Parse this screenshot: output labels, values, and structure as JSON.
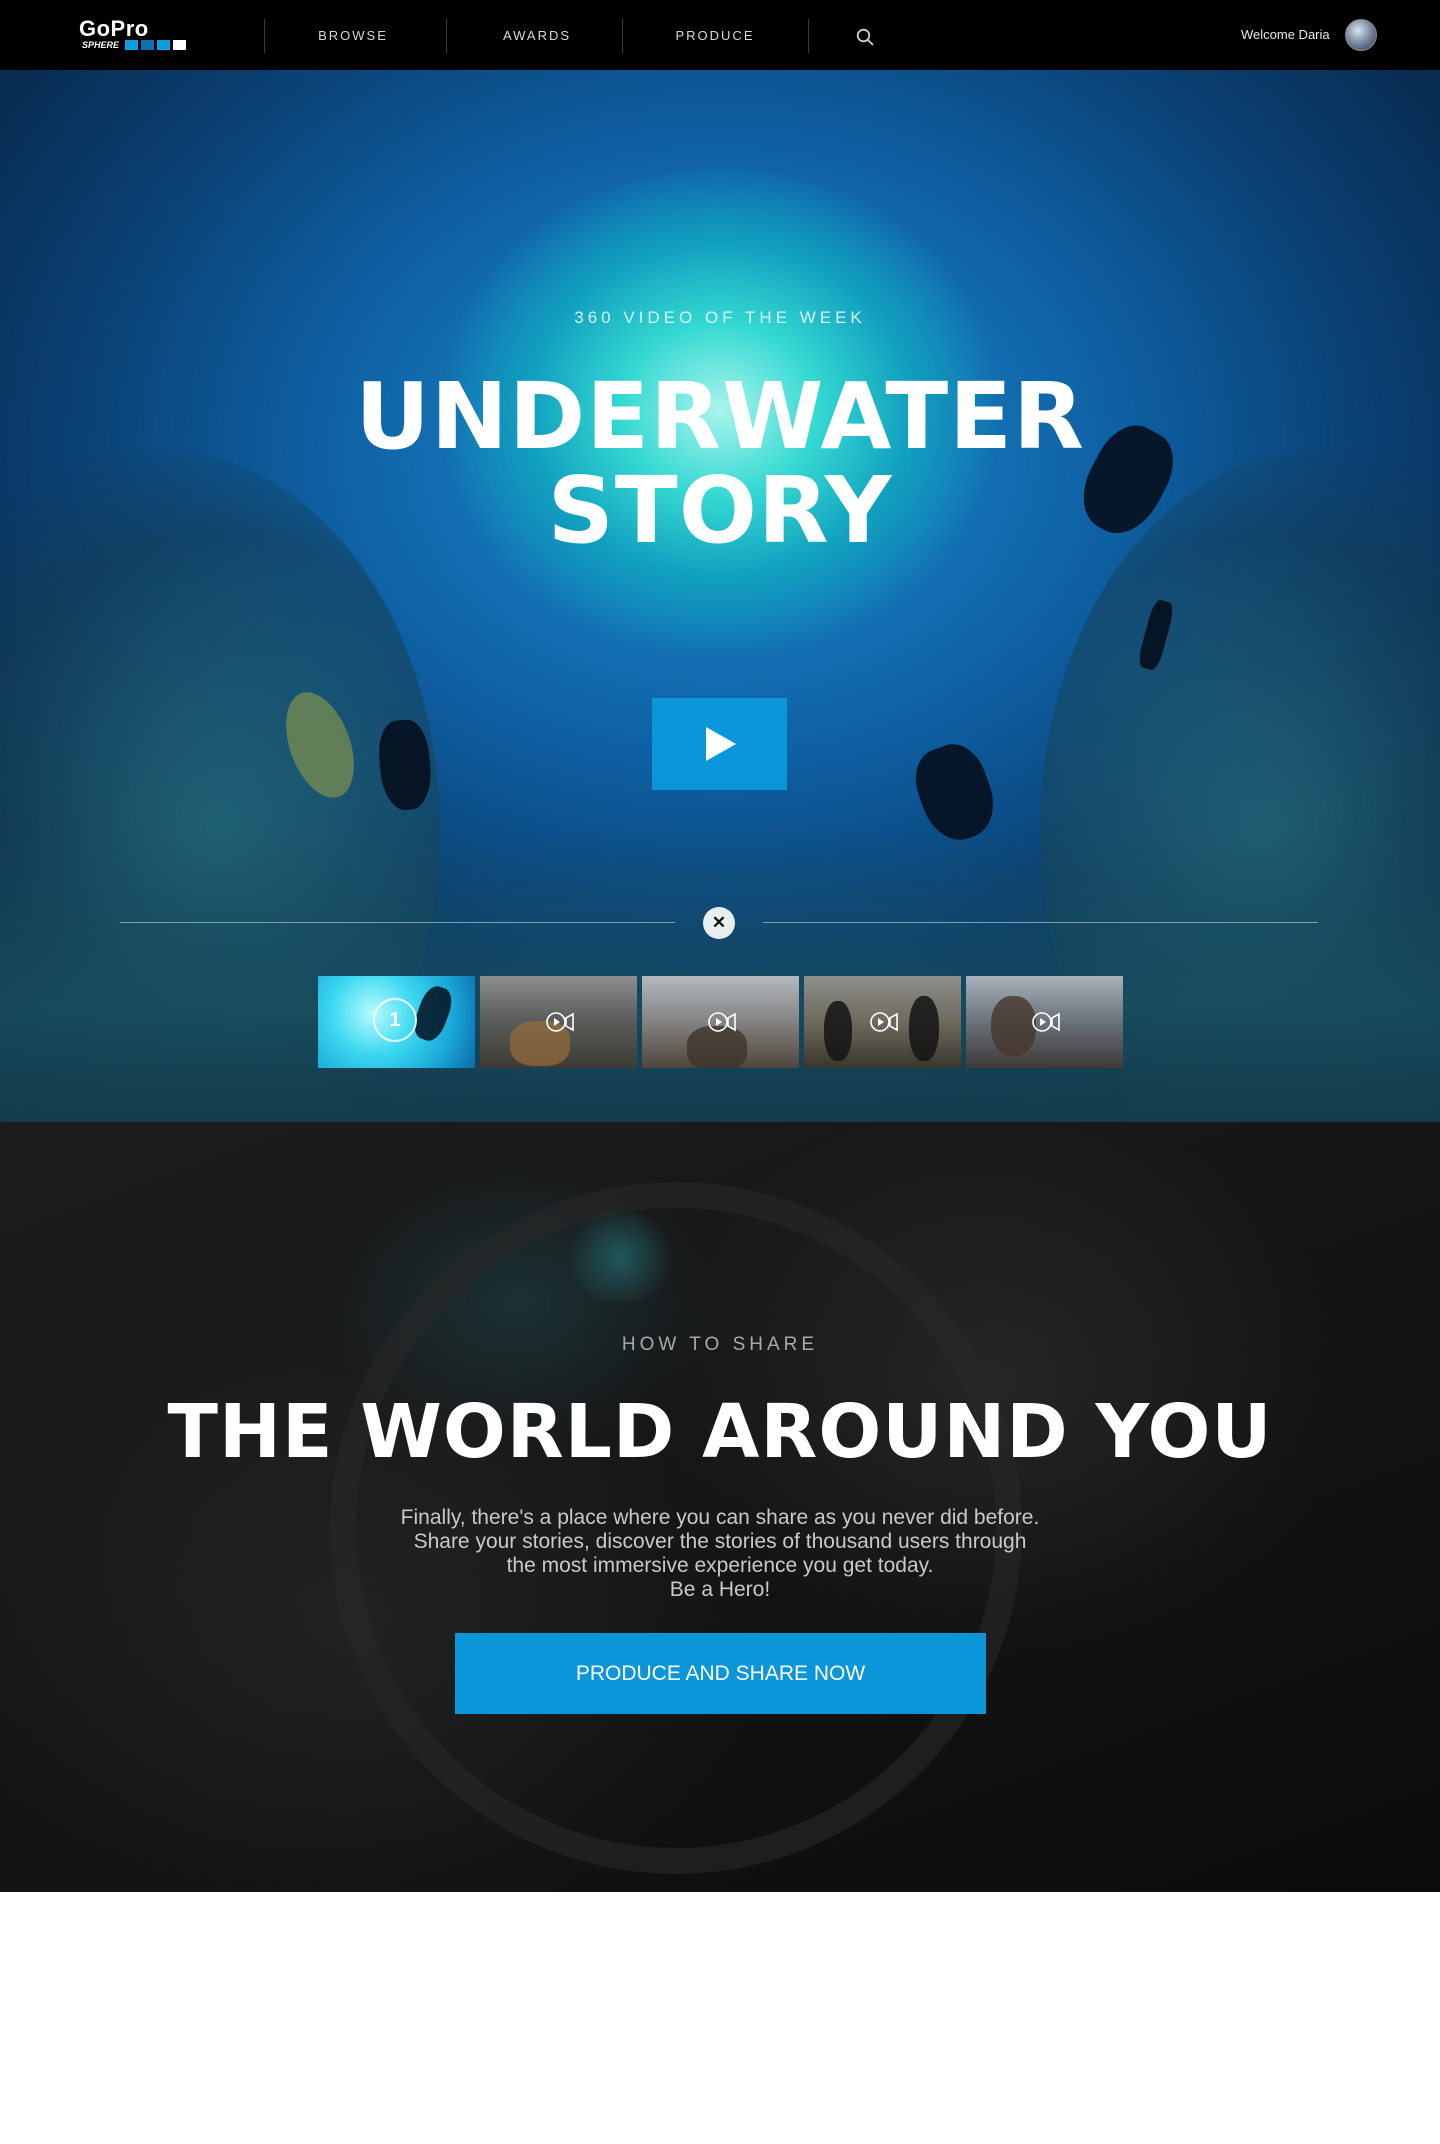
{
  "nav": {
    "logo_text": "GoPro",
    "logo_sub": "SPHERE",
    "links": [
      "BROWSE",
      "AWARDS",
      "PRODUCE"
    ],
    "welcome": "Welcome Daria"
  },
  "hero": {
    "eyebrow": "360 VIDEO OF THE WEEK",
    "title_line1": "UNDERWATER",
    "title_line2": "STORY",
    "active_thumb_number": "1",
    "thumbnails": [
      "underwater-divers",
      "paddle-boat-group",
      "snow-park-skier",
      "penguins-on-ice",
      "mountain-selfie"
    ]
  },
  "share": {
    "eyebrow": "HOW TO SHARE",
    "title": "THE WORLD AROUND YOU",
    "body_lines": [
      "Finally, there's a place where you can share as you never did before.",
      "Share your stories, discover the stories of thousand users through",
      "the most immersive experience you get today.",
      "Be a Hero!"
    ],
    "cta": "PRODUCE AND SHARE NOW"
  },
  "colors": {
    "accent": "#0a96d8",
    "nav_bg": "#000000",
    "share_bg": "#141414"
  },
  "icons": [
    "search-icon",
    "play-icon",
    "close-icon",
    "video-camera-icon"
  ]
}
